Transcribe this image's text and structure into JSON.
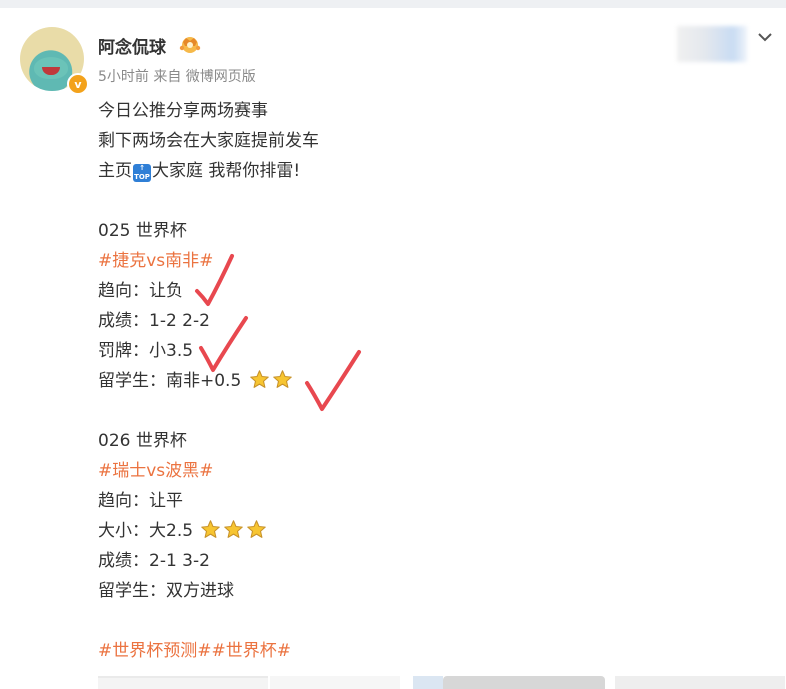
{
  "post": {
    "username": "阿念侃球",
    "meta": "5小时前 来自 微博网页版",
    "lines": [
      {
        "text": "今日公推分享两场赛事"
      },
      {
        "text": "剩下两场会在大家庭提前发车"
      },
      {
        "text_before": "主页",
        "badge": "TOP",
        "text_after": "大家庭 我帮你排雷!"
      },
      {
        "text": "025 世界杯"
      },
      {
        "hashtag": "#捷克vs南非#"
      },
      {
        "text": "趋向：让负"
      },
      {
        "text": "成绩：1-2 2-2"
      },
      {
        "text": "罚牌：小3.5"
      },
      {
        "text": "留学生：南非+0.5",
        "stars": 2
      },
      {
        "text": "026 世界杯"
      },
      {
        "hashtag": "#瑞士vs波黑#"
      },
      {
        "text": "趋向：让平"
      },
      {
        "text": "大小：大2.5",
        "stars": 3
      },
      {
        "text": "成绩：2-1 3-2"
      },
      {
        "text": "留学生：双方进球"
      },
      {
        "hashtag": "#世界杯预测##世界杯#"
      }
    ]
  },
  "icons": {
    "crown": "crown-badge-icon",
    "verified": "verified-badge-icon",
    "chevron": "chevron-down-icon",
    "star": "star-icon",
    "check": "red-checkmark-icon"
  },
  "colors": {
    "hashtag": "#eb7340",
    "text": "#333333",
    "meta": "#8a8a8a",
    "check": "#e8484f",
    "star": "#f7c531"
  }
}
